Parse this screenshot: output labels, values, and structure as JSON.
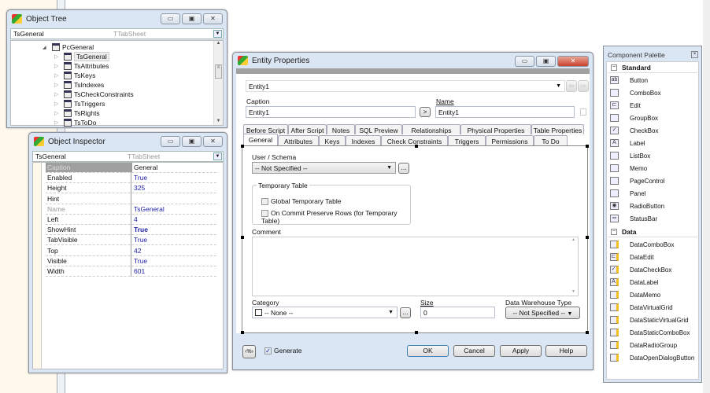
{
  "object_tree": {
    "title": "Object Tree",
    "selected_name": "TsGeneral",
    "selected_type": "TTabSheet",
    "root": "PcGeneral",
    "items": [
      "TsGeneral",
      "TsAttributes",
      "TsKeys",
      "TsIndexes",
      "TsCheckConstraints",
      "TsTriggers",
      "TsRights",
      "TsToDo"
    ]
  },
  "object_inspector": {
    "title": "Object Inspector",
    "selected_name": "TsGeneral",
    "selected_type": "TTabSheet",
    "properties": [
      {
        "k": "Caption",
        "v": "General"
      },
      {
        "k": "Enabled",
        "v": "True"
      },
      {
        "k": "Height",
        "v": "325"
      },
      {
        "k": "Hint",
        "v": ""
      },
      {
        "k": "Name",
        "v": "TsGeneral"
      },
      {
        "k": "Left",
        "v": "4"
      },
      {
        "k": "ShowHint",
        "v": "True"
      },
      {
        "k": "TabVisible",
        "v": "True"
      },
      {
        "k": "Top",
        "v": "42"
      },
      {
        "k": "Visible",
        "v": "True"
      },
      {
        "k": "Width",
        "v": "601"
      }
    ]
  },
  "entity": {
    "title": "Entity Properties",
    "entity_select": "Entity1",
    "caption_label": "Caption",
    "caption_value": "Entity1",
    "copy_btn": ">",
    "name_label": "Name",
    "name_value": "Entity1",
    "tabs_row1": [
      "Before Script",
      "After Script",
      "Notes",
      "SQL Preview",
      "Relationships",
      "Physical Properties",
      "Table Properties"
    ],
    "tabs_row2": [
      "General",
      "Attributes",
      "Keys",
      "Indexes",
      "Check Constraints",
      "Triggers",
      "Permissions",
      "To Do"
    ],
    "user_schema_label": "User / Schema",
    "user_schema_value": "-- Not Specified --",
    "ellipsis": "...",
    "temp_group": "Temporary Table",
    "temp_global": "Global Temporary Table",
    "temp_commit": "On Commit Preserve Rows (for Temporary Table)",
    "comment_label": "Comment",
    "comment_value": "",
    "category_label": "Category",
    "category_value": "-- None --",
    "size_label": "Size",
    "size_value": "0",
    "dw_label": "Data Warehouse Type",
    "dw_value": "-- Not Specified --",
    "generate_label": "Generate",
    "generate_checked": true,
    "buttons": {
      "ok": "OK",
      "cancel": "Cancel",
      "apply": "Apply",
      "help": "Help"
    }
  },
  "palette": {
    "title": "Component Palette",
    "sections": [
      {
        "name": "Standard",
        "items": [
          "Button",
          "ComboBox",
          "Edit",
          "GroupBox",
          "CheckBox",
          "Label",
          "ListBox",
          "Memo",
          "PageControl",
          "Panel",
          "RadioButton",
          "StatusBar"
        ]
      },
      {
        "name": "Data",
        "items": [
          "DataComboBox",
          "DataEdit",
          "DataCheckBox",
          "DataLabel",
          "DataMemo",
          "DataVirtualGrid",
          "DataStaticVirtualGrid",
          "DataStaticComboBox",
          "DataRadioGroup",
          "DataOpenDialogButton"
        ]
      }
    ]
  }
}
